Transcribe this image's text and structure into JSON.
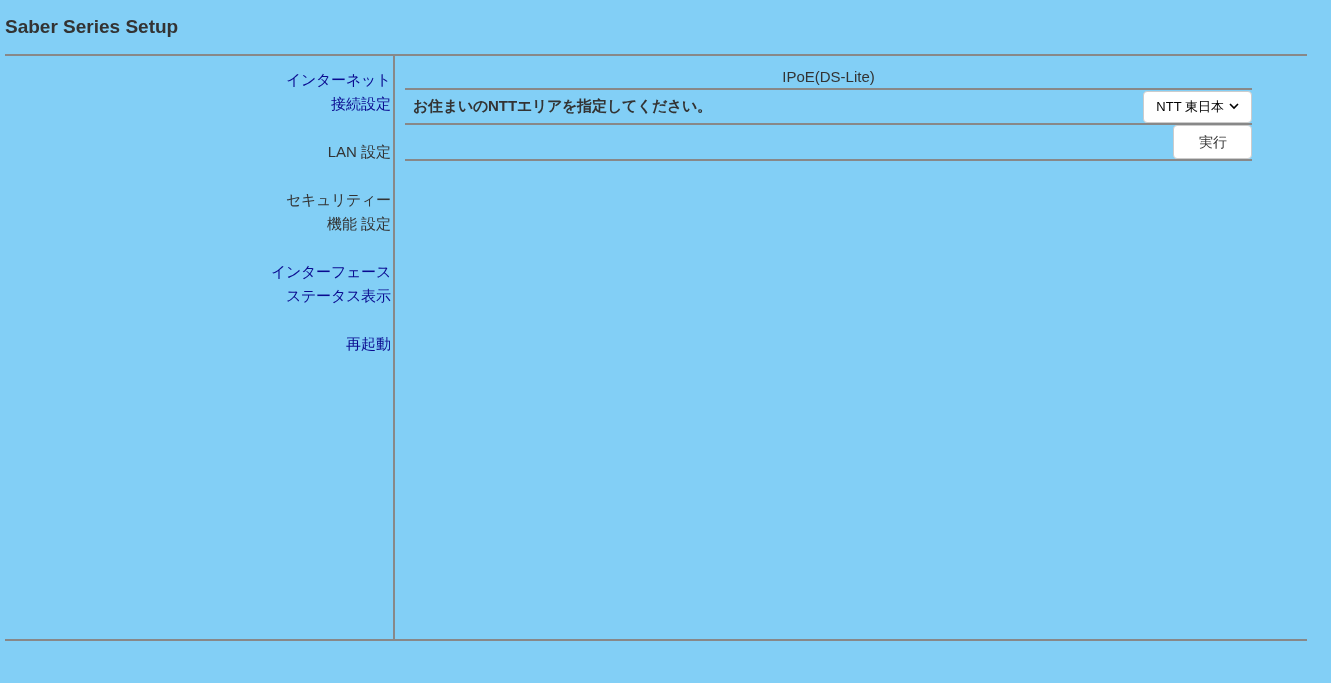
{
  "header": {
    "title": "Saber Series Setup"
  },
  "sidebar": {
    "items": [
      {
        "kind": "link",
        "lines": [
          "インターネット",
          "接続設定"
        ]
      },
      {
        "kind": "text",
        "lines": [
          "LAN 設定"
        ]
      },
      {
        "kind": "text",
        "lines": [
          "セキュリティー",
          "機能 設定"
        ]
      },
      {
        "kind": "link",
        "lines": [
          "インターフェース",
          "ステータス表示"
        ]
      },
      {
        "kind": "link",
        "lines": [
          "再起動"
        ]
      }
    ]
  },
  "main": {
    "section_title": "IPoE(DS-Lite)",
    "prompt": "お住まいのNTTエリアを指定してください。",
    "area_select": {
      "value": "NTT 東日本"
    },
    "run_button": "実行"
  }
}
